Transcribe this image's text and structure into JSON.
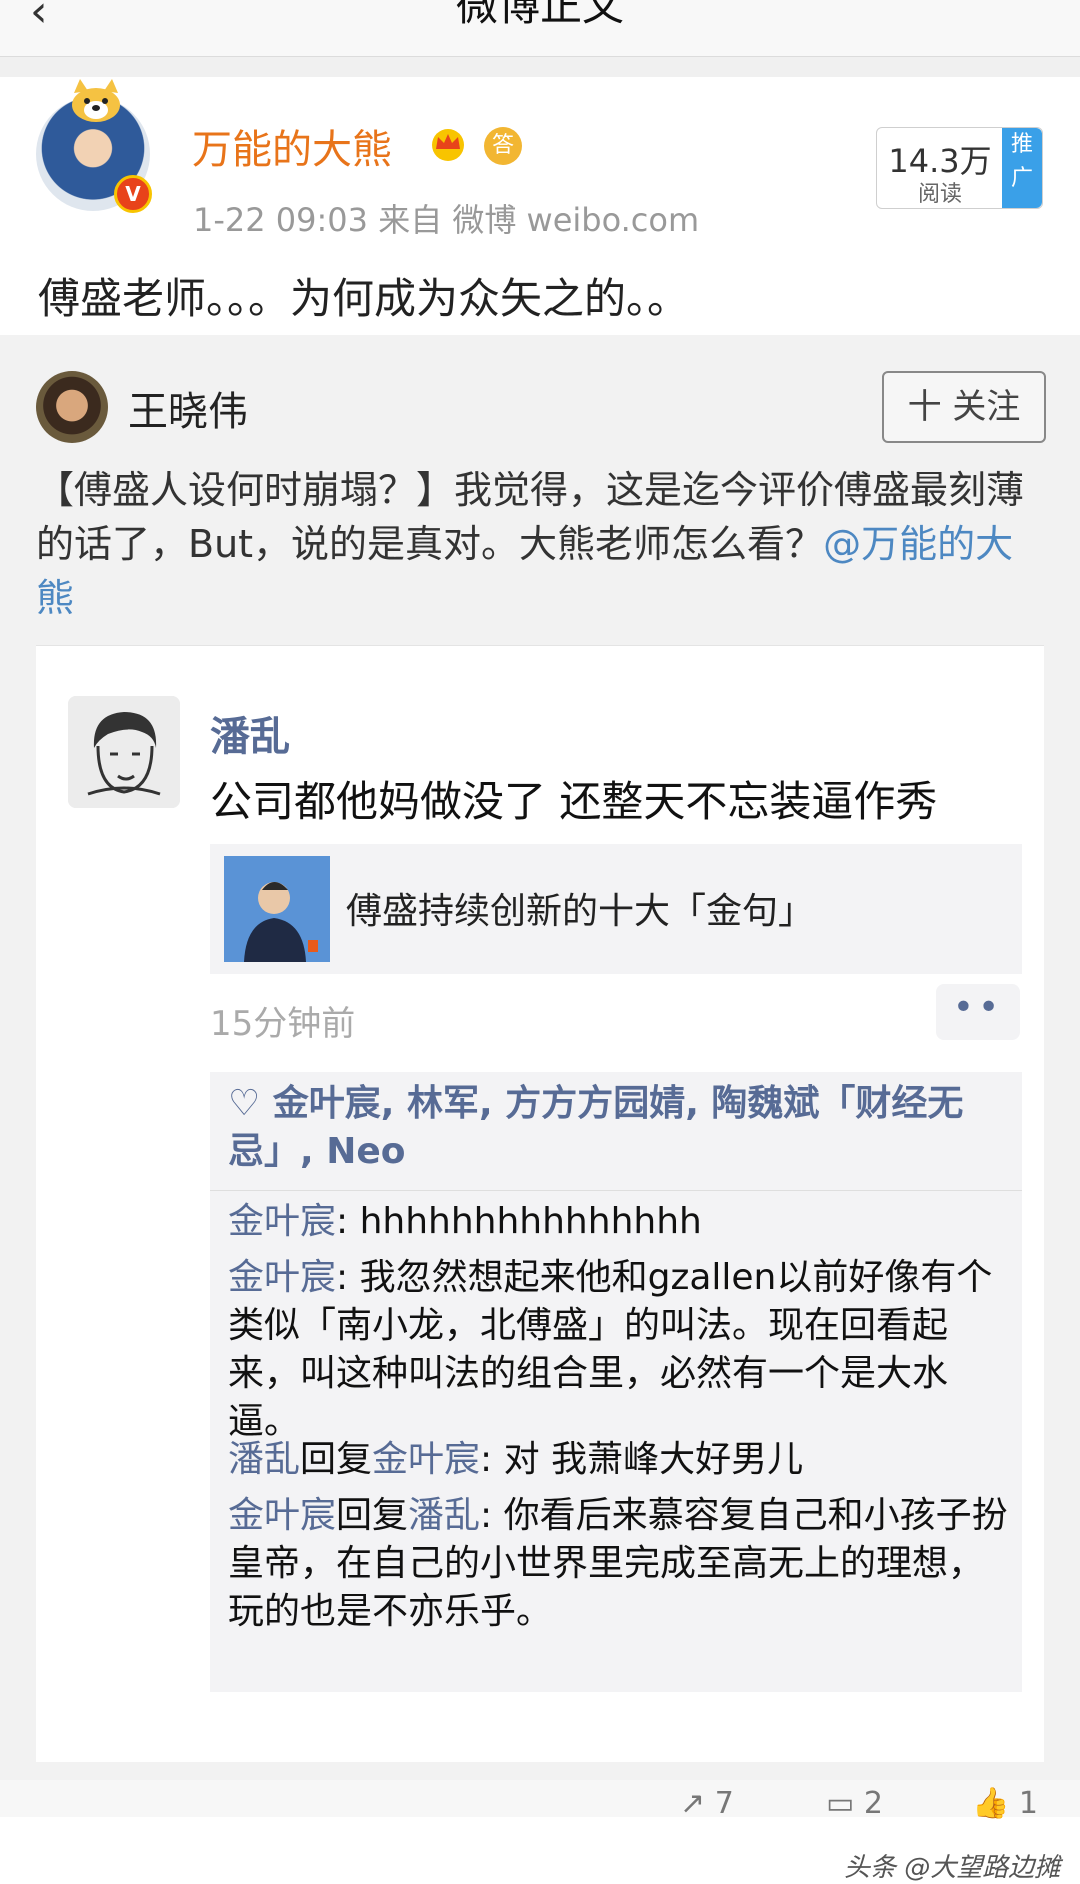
{
  "nav": {
    "title": "微博正文",
    "back_icon": "chevron-left-icon"
  },
  "post": {
    "author": "万能的大熊",
    "verified_badge": "V",
    "ans_badge": "答",
    "meta": "1-22 09:03  来自 微博 weibo.com",
    "reads": {
      "count": "14.3万",
      "label": "阅读",
      "promo": "推广"
    },
    "text": "傅盛老师。。。为何成为众矢之的。。"
  },
  "repost": {
    "author": "王晓伟",
    "follow_label": "十 关注",
    "text_main": "【傅盛人设何时崩塌？】我觉得，这是迄今评价傅盛最刻薄的话了，But，说的是真对。大熊老师怎么看？",
    "mention": "@万能的大熊"
  },
  "screenshot": {
    "author": "潘乱",
    "text": "公司都他妈做没了 还整天不忘装逼作秀",
    "link_title": "傅盛持续创新的十大「金句」",
    "time": "15分钟前",
    "more": "••",
    "likes": "♡ 金叶宸, 林军, 方方方园婧, 陶魏斌「财经无忌」, Neo",
    "comments": [
      {
        "name": "金叶宸",
        "reply_to": "",
        "text": ": hhhhhhhhhhhhhhh"
      },
      {
        "name": "金叶宸",
        "reply_to": "",
        "text": ": 我忽然想起来他和gzallen以前好像有个类似「南小龙，北傅盛」的叫法。现在回看起来，叫这种叫法的组合里，必然有一个是大水逼。"
      },
      {
        "name": "潘乱",
        "reply_word": "回复",
        "reply_to": "金叶宸",
        "text": ": 对 我萧峰大好男儿"
      },
      {
        "name": "金叶宸",
        "reply_word": "回复",
        "reply_to": "潘乱",
        "text": ": 你看后来慕容复自己和小孩子扮皇帝，在自己的小世界里完成至高无上的理想，玩的也是不亦乐乎。"
      }
    ],
    "watermark": "头条 @大望路边摊"
  },
  "actions": {
    "repost": "7",
    "comment": "2",
    "like": "1"
  }
}
